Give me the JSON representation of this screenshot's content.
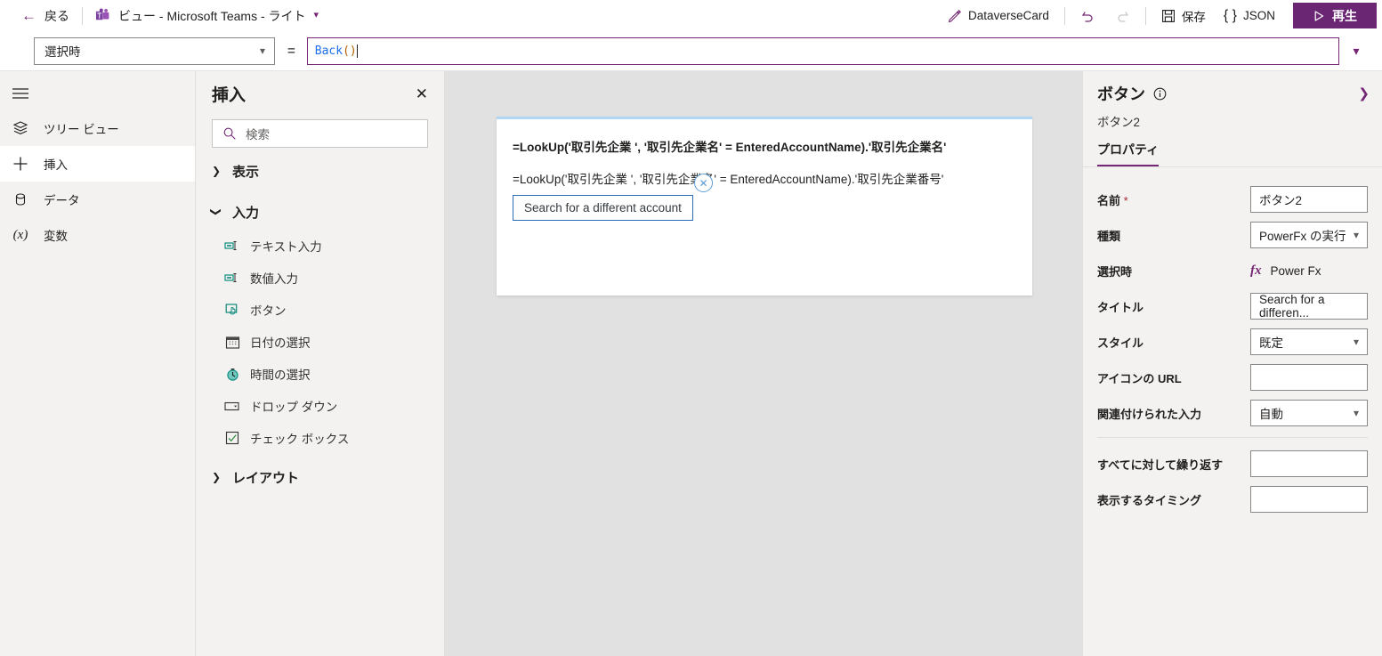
{
  "titlebar": {
    "back_label": "戻る",
    "app_title": "ビュー - Microsoft Teams - ライト",
    "card_name": "DataverseCard",
    "undo_label": "元に戻す",
    "redo_label": "やり直し",
    "save_label": "保存",
    "json_label": "JSON",
    "play_label": "再生"
  },
  "formulabar": {
    "property": "選択時",
    "equals": "=",
    "formula_fn": "Back",
    "formula_paren": "()"
  },
  "rail": {
    "items": [
      {
        "label": "ツリー ビュー",
        "icon": "tree-view-icon"
      },
      {
        "label": "挿入",
        "icon": "plus-icon"
      },
      {
        "label": "データ",
        "icon": "database-icon"
      },
      {
        "label": "変数",
        "icon": "variable-icon"
      }
    ]
  },
  "insert_panel": {
    "title": "挿入",
    "search_placeholder": "検索",
    "groups": [
      {
        "label": "表示",
        "expanded": false,
        "items": []
      },
      {
        "label": "入力",
        "expanded": true,
        "items": [
          {
            "label": "テキスト入力",
            "icon": "text-input-icon"
          },
          {
            "label": "数値入力",
            "icon": "number-input-icon"
          },
          {
            "label": "ボタン",
            "icon": "button-icon"
          },
          {
            "label": "日付の選択",
            "icon": "calendar-icon"
          },
          {
            "label": "時間の選択",
            "icon": "clock-icon"
          },
          {
            "label": "ドロップ ダウン",
            "icon": "dropdown-icon"
          },
          {
            "label": "チェック ボックス",
            "icon": "checkbox-icon"
          }
        ]
      },
      {
        "label": "レイアウト",
        "expanded": false,
        "items": []
      }
    ]
  },
  "canvas": {
    "card": {
      "line1": "=LookUp('取引先企業 ', '取引先企業名' = EnteredAccountName).'取引先企業名'",
      "line2": "=LookUp('取引先企業 ', '取引先企業名' = EnteredAccountName).'取引先企業番号'",
      "button_label": "Search for a different account"
    }
  },
  "properties": {
    "title": "ボタン",
    "subtitle": "ボタン2",
    "tabs": [
      {
        "label": "プロパティ",
        "active": true
      }
    ],
    "rows": [
      {
        "label": "名前",
        "required": true,
        "type": "text",
        "value": "ボタン2"
      },
      {
        "label": "種類",
        "required": false,
        "type": "select",
        "value": "PowerFx の実行"
      },
      {
        "label": "選択時",
        "required": false,
        "type": "fx",
        "value": "Power Fx"
      },
      {
        "label": "タイトル",
        "required": false,
        "type": "text",
        "value": "Search for a differen..."
      },
      {
        "label": "スタイル",
        "required": false,
        "type": "select",
        "value": "既定"
      },
      {
        "label": "アイコンの URL",
        "required": false,
        "type": "text",
        "value": ""
      },
      {
        "label": "関連付けられた入力",
        "required": false,
        "type": "select",
        "value": "自動"
      },
      {
        "label": "すべてに対して繰り返す",
        "required": false,
        "type": "text",
        "value": ""
      },
      {
        "label": "表示するタイミング",
        "required": false,
        "type": "text",
        "value": ""
      }
    ]
  },
  "colors": {
    "brand_purple": "#742774",
    "play_button": "#6b2673",
    "canvas_bg": "#e1e1e1",
    "panel_bg": "#f3f2f1",
    "card_top_border": "#b3d6f2",
    "accent_teal": "#0e8a7d",
    "required_red": "#a4262c"
  }
}
